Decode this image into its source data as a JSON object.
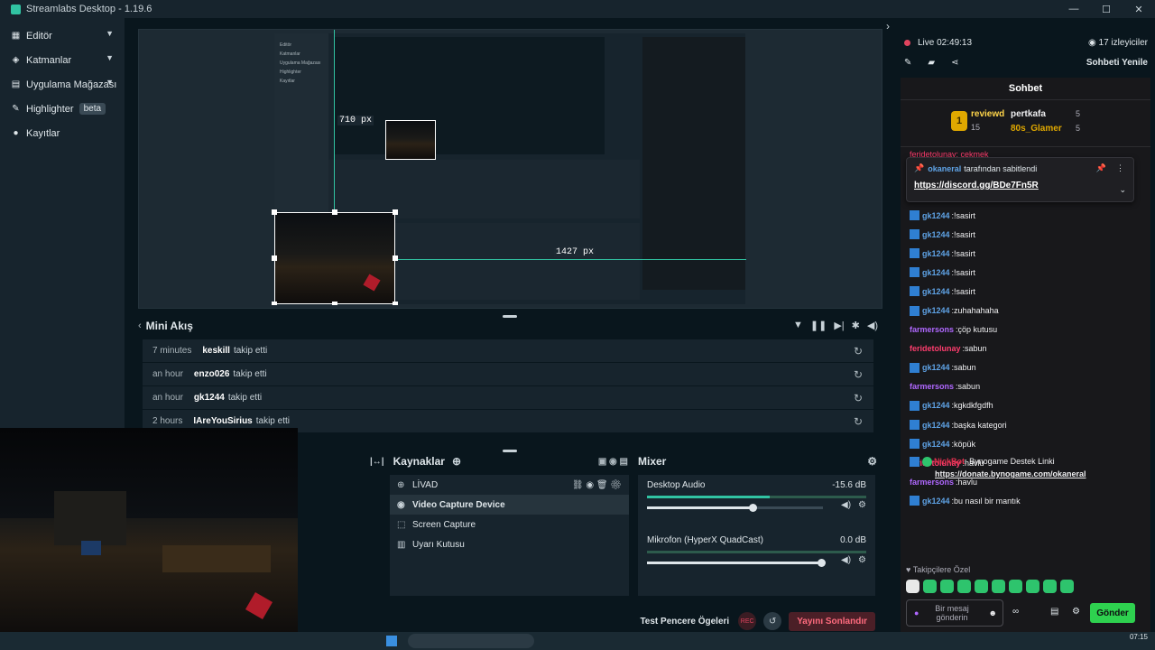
{
  "window": {
    "title": "Streamlabs Desktop - 1.19.6"
  },
  "sidebar": {
    "items": [
      {
        "label": "Editör",
        "icon": "editor-icon",
        "expandable": true
      },
      {
        "label": "Katmanlar",
        "icon": "layers-icon",
        "expandable": true
      },
      {
        "label": "Uygulama Mağazası",
        "icon": "store-icon",
        "expandable": true
      },
      {
        "label": "Highlighter",
        "icon": "highlighter-icon",
        "badge": "beta"
      },
      {
        "label": "Kayıtlar",
        "icon": "recordings-icon"
      }
    ]
  },
  "preview": {
    "guide_label_vertical": "710 px",
    "guide_label_horizontal": "1427 px",
    "nested_rows": [
      "Editör",
      "Katmanlar",
      "Uygulama Mağazası",
      "Highlighter",
      "Kayıtlar"
    ]
  },
  "mini_feed": {
    "title": "Mini Akış",
    "events": [
      {
        "time": "7 minutes",
        "user": "keskill",
        "action": "takip etti"
      },
      {
        "time": "an hour",
        "user": "enzo026",
        "action": "takip etti"
      },
      {
        "time": "an hour",
        "user": "gk1244",
        "action": "takip etti"
      },
      {
        "time": "2 hours",
        "user": "IAreYouSirius",
        "action": "takip etti"
      }
    ]
  },
  "sources": {
    "title": "Kaynaklar",
    "items": [
      {
        "label": "LİVAD",
        "icon": "globe-icon"
      },
      {
        "label": "Video Capture Device",
        "icon": "webcam-icon",
        "selected": true
      },
      {
        "label": "Screen Capture",
        "icon": "screen-capture-icon"
      },
      {
        "label": "Uyarı Kutusu",
        "icon": "alert-box-icon"
      }
    ]
  },
  "mixer": {
    "title": "Mixer",
    "channels": [
      {
        "name": "Desktop Audio",
        "level": "-15.6 dB",
        "meter": 0.56,
        "volume": 0.6
      },
      {
        "name": "Mikrofon (HyperX QuadCast)",
        "level": "0.0 dB",
        "meter": 0.0,
        "volume": 0.99
      }
    ]
  },
  "footer": {
    "test_label": "Test Pencere Ögeleri",
    "rec_label": "REC",
    "end_button": "Yayını Sonlandır"
  },
  "stream": {
    "status": "Live 02:49:13",
    "viewers": "17 izleyiciler",
    "refresh_chat": "Sohbeti Yenile"
  },
  "chat": {
    "title": "Sohbet",
    "leaderboard": [
      {
        "rank": "1",
        "name": "reviewd",
        "count": "15"
      },
      {
        "name": "pertkafa",
        "count": "5"
      },
      {
        "name": "80s_Glamer",
        "count": "5"
      }
    ],
    "behind_pin": "feridetolunay: çekmek",
    "pinned": {
      "by_user": "okaneral",
      "by_text": "tarafından sabitlendi",
      "link": "https://discord.gg/BDe7Fn5R"
    },
    "messages": [
      {
        "user": "gk1244",
        "text": "!sasirt",
        "color": "#5fa3e6",
        "badge": "blue"
      },
      {
        "user": "gk1244",
        "text": "!sasirt",
        "color": "#5fa3e6",
        "badge": "blue"
      },
      {
        "user": "gk1244",
        "text": "!sasirt",
        "color": "#5fa3e6",
        "badge": "blue"
      },
      {
        "user": "gk1244",
        "text": "!sasirt",
        "color": "#5fa3e6",
        "badge": "blue"
      },
      {
        "user": "gk1244",
        "text": "!sasirt",
        "color": "#5fa3e6",
        "badge": "blue"
      },
      {
        "user": "gk1244",
        "text": "zuhahahaha",
        "color": "#5fa3e6",
        "badge": "blue"
      },
      {
        "user": "farmersons",
        "text": "çöp kutusu",
        "color": "#b068ff",
        "badge": ""
      },
      {
        "user": "feridetolunay",
        "text": "sabun",
        "color": "#ff3d6e",
        "badge": ""
      },
      {
        "user": "gk1244",
        "text": "sabun",
        "color": "#5fa3e6",
        "badge": "blue"
      },
      {
        "user": "farmersons",
        "text": "sabun",
        "color": "#b068ff",
        "badge": ""
      },
      {
        "user": "gk1244",
        "text": "kgkdkfgdfh",
        "color": "#5fa3e6",
        "badge": "blue"
      },
      {
        "user": "gk1244",
        "text": "başka kategori",
        "color": "#5fa3e6",
        "badge": "blue"
      },
      {
        "user": "gk1244",
        "text": "köpük",
        "color": "#5fa3e6",
        "badge": "blue"
      },
      {
        "user": "feridetolunay",
        "text": "havlu",
        "color": "#ff3d6e",
        "badge": ""
      },
      {
        "user": "farmersons",
        "text": "havlu",
        "color": "#b068ff",
        "badge": ""
      },
      {
        "user": "gk1244",
        "text": "bu nasıl bir mantık",
        "color": "#5fa3e6",
        "badge": "blue"
      }
    ],
    "bot": {
      "user": "NickBot",
      "text": "Bynogame Destek Linki",
      "link": "https://donate.bynogame.com/okaneral"
    },
    "follower_emotes_label": "Takipçilere Özel",
    "input_placeholder": "Bir mesaj gönderin",
    "send_label": "Gönder"
  },
  "taskbar": {
    "time": "07:15"
  }
}
